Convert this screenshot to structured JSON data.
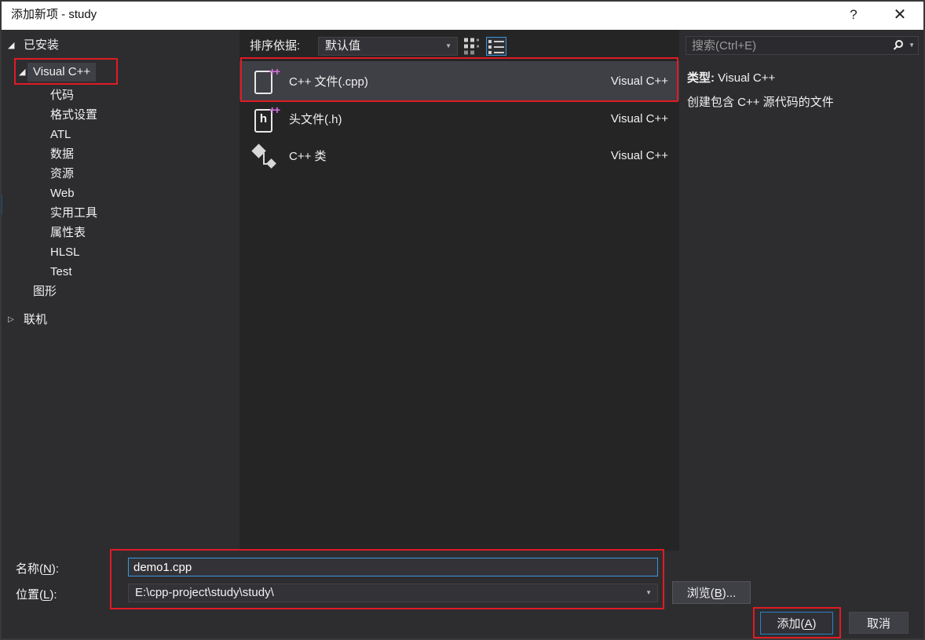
{
  "window": {
    "title": "添加新项 - study",
    "help": "?",
    "close": "✕"
  },
  "icons": {
    "tree_expanded": "◢",
    "tree_collapsed": "▷",
    "combo_caret": "▼"
  },
  "sidebar": {
    "items": [
      {
        "label": "已安装"
      },
      {
        "label": "Visual C++"
      },
      {
        "label": "代码"
      },
      {
        "label": "格式设置"
      },
      {
        "label": "ATL"
      },
      {
        "label": "数据"
      },
      {
        "label": "资源"
      },
      {
        "label": "Web"
      },
      {
        "label": "实用工具"
      },
      {
        "label": "属性表"
      },
      {
        "label": "HLSL"
      },
      {
        "label": "Test"
      },
      {
        "label": "图形"
      },
      {
        "label": "联机"
      }
    ]
  },
  "toolbar": {
    "sort_label": "排序依据:",
    "sort_value": "默认值"
  },
  "templates": [
    {
      "name": "C++ 文件(.cpp)",
      "category": "Visual C++",
      "icon_badge": "++"
    },
    {
      "name": "头文件(.h)",
      "category": "Visual C++",
      "icon_badge": "++",
      "icon_letter": "h"
    },
    {
      "name": "C++ 类",
      "category": "Visual C++"
    }
  ],
  "details": {
    "search_placeholder": "搜索(Ctrl+E)",
    "type_label": "类型:",
    "type_value": "Visual C++",
    "description": "创建包含 C++ 源代码的文件"
  },
  "footer": {
    "name_label": {
      "pre": "名称(",
      "key": "N",
      "post": "):"
    },
    "name_value": "demo1.cpp",
    "location_label": {
      "pre": "位置(",
      "key": "L",
      "post": "):"
    },
    "location_value": "E:\\cpp-project\\study\\study\\",
    "browse_label": {
      "pre": "浏览(",
      "key": "B",
      "post": ")..."
    },
    "add_label": {
      "pre": "添加(",
      "key": "A",
      "post": ")"
    },
    "cancel_label": "取消"
  },
  "colors": {
    "dialog_bg": "#2d2d30",
    "list_bg": "#252526",
    "selection": "#3f3f46",
    "accent_blue": "#3a96dd",
    "annotation_red": "#e01b24",
    "icon_magenta": "#d873e0",
    "titlebar_bg": "#ffffff"
  }
}
